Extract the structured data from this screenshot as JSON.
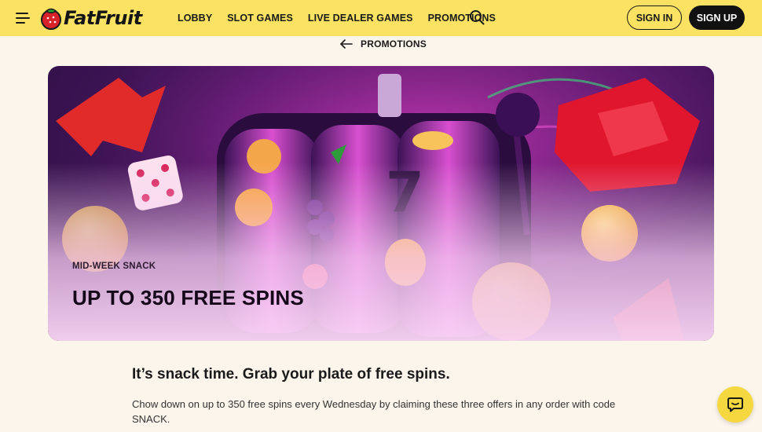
{
  "header": {
    "logo_text": "FatFruit",
    "nav": [
      "LOBBY",
      "SLOT GAMES",
      "LIVE DEALER GAMES",
      "PROMOTIONS"
    ],
    "sign_in": "SIGN IN",
    "sign_up": "SIGN UP",
    "icons": {
      "menu": "menu-icon",
      "search": "search-icon",
      "logo": "strawberry-icon"
    }
  },
  "breadcrumb": {
    "label": "PROMOTIONS",
    "icon": "arrow-left-icon"
  },
  "banner": {
    "eyebrow": "MID-WEEK SNACK",
    "title": "UP TO 350 FREE SPINS"
  },
  "content": {
    "headline": "It’s snack time. Grab your plate of free spins.",
    "body": "Chow down on up to 350 free spins every Wednesday by claiming these three offers in any order with code SNACK."
  },
  "chat": {
    "icon": "chat-icon"
  },
  "colors": {
    "header_bg": "#fbe262",
    "page_bg": "#fbf5ec",
    "primary_dark": "#111111",
    "chat_bg": "#f5d83f"
  }
}
